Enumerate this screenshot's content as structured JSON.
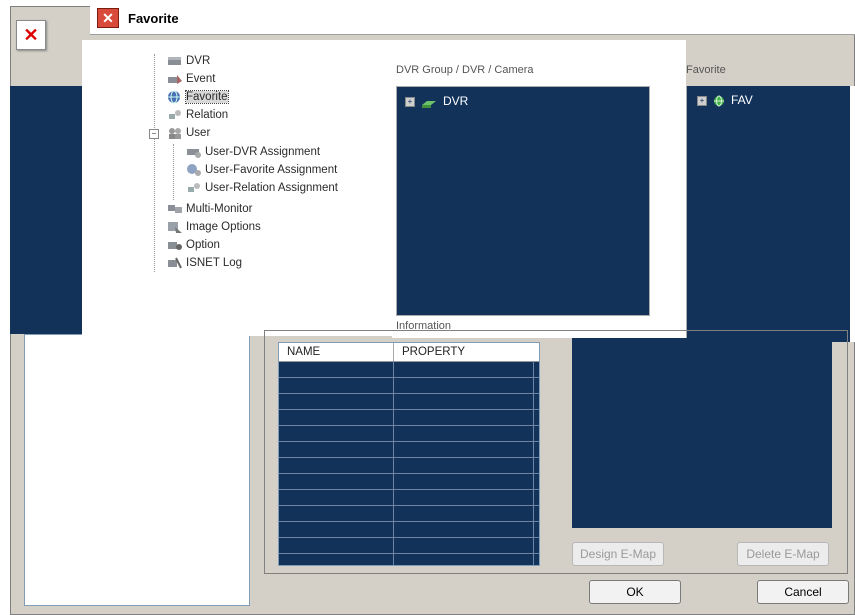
{
  "window": {
    "title": "Favorite",
    "title_close_glyph": "✕",
    "corner_close_glyph": "✕"
  },
  "tree": {
    "items": [
      {
        "label": "DVR",
        "icon": "dvr-icon"
      },
      {
        "label": "Event",
        "icon": "event-icon"
      },
      {
        "label": "Favorite",
        "icon": "favorite-globe-icon",
        "selected": true
      },
      {
        "label": "Relation",
        "icon": "relation-icon"
      },
      {
        "label": "User",
        "icon": "user-icon",
        "expanded": true
      },
      {
        "label": "User-DVR Assignment",
        "icon": "user-dvr-icon"
      },
      {
        "label": "User-Favorite Assignment",
        "icon": "user-favorite-icon"
      },
      {
        "label": "User-Relation Assignment",
        "icon": "user-relation-icon"
      },
      {
        "label": "Multi-Monitor",
        "icon": "multi-monitor-icon"
      },
      {
        "label": "Image Options",
        "icon": "image-options-icon"
      },
      {
        "label": "Option",
        "icon": "option-icon"
      },
      {
        "label": "ISNET Log",
        "icon": "log-icon"
      }
    ],
    "expander_minus": "−"
  },
  "dvr_panel": {
    "header": "DVR Group / DVR / Camera",
    "items": [
      {
        "label": "DVR",
        "expander": "+"
      }
    ]
  },
  "favorite_panel": {
    "header": "Favorite",
    "items": [
      {
        "label": "FAV",
        "expander": "+"
      }
    ]
  },
  "information": {
    "label": "Information",
    "columns": [
      "NAME",
      "PROPERTY"
    ]
  },
  "buttons": {
    "design_emap": "Design E-Map",
    "delete_emap": "Delete E-Map",
    "ok": "OK",
    "cancel": "Cancel"
  },
  "colors": {
    "dark_navy": "#12325a",
    "dialog_gray": "#d4d0c8",
    "close_red": "#d94a3a"
  }
}
